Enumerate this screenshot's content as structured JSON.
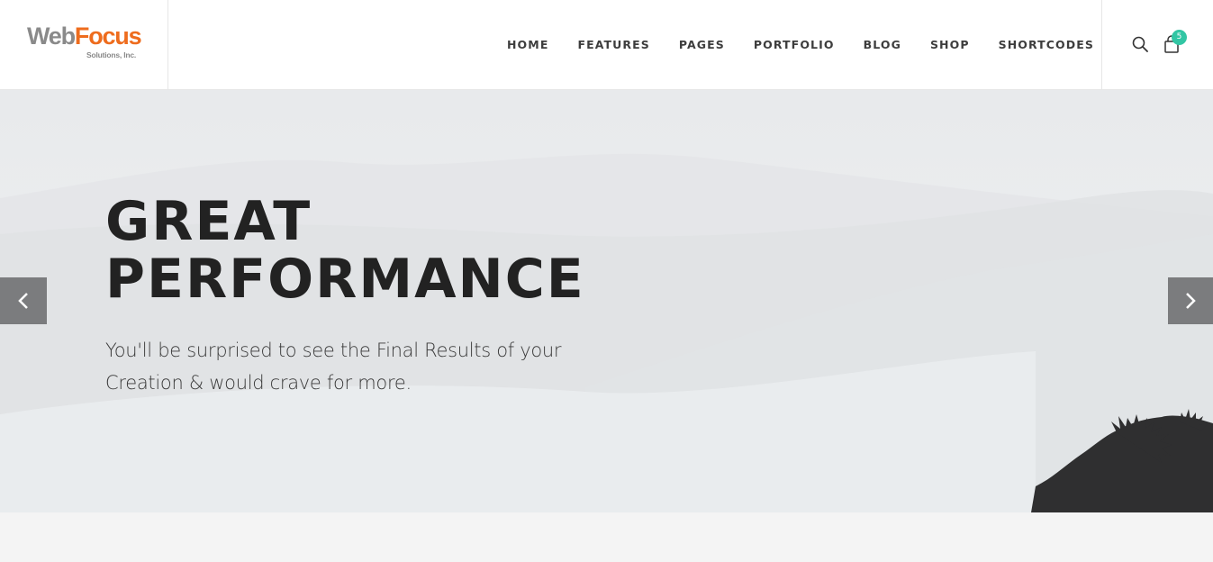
{
  "logo": {
    "brand_part1": "Web",
    "brand_part2": "Focus",
    "tagline": "Solutions, Inc."
  },
  "nav": {
    "items": [
      {
        "label": "HOME"
      },
      {
        "label": "FEATURES"
      },
      {
        "label": "PAGES"
      },
      {
        "label": "PORTFOLIO"
      },
      {
        "label": "BLOG"
      },
      {
        "label": "SHOP"
      },
      {
        "label": "SHORTCODES"
      }
    ]
  },
  "header_icons": {
    "search": "search-icon",
    "cart": "shopping-bag-icon",
    "cart_count": "5"
  },
  "hero": {
    "title_line1": "GREAT",
    "title_line2": "PERFORMANCE",
    "subtitle_line1": "You'll be surprised to see the Final Results of your",
    "subtitle_line2": "Creation & would crave for more.",
    "prev_icon": "chevron-left-icon",
    "next_icon": "chevron-right-icon"
  },
  "colors": {
    "accent_orange": "#ee6c1d",
    "badge_green": "#32c6a4",
    "arrow_bg": "#7b7c7e",
    "title_text": "#222222"
  }
}
